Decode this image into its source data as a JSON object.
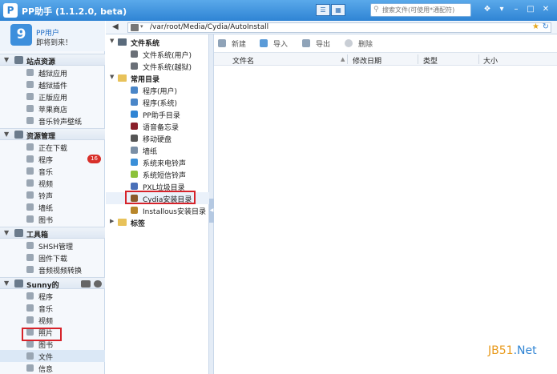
{
  "app": {
    "title": "PP助手 (1.1.2.0, beta)",
    "logo_char": "P"
  },
  "search": {
    "placeholder": "搜索文件(可使用*通配符)"
  },
  "user": {
    "name": "PP用户",
    "welcome": "即将到来！",
    "avatar_char": "9"
  },
  "sidebar": {
    "sections": [
      {
        "label": "站点资源",
        "items": [
          "越狱应用",
          "越狱插件",
          "正版应用",
          "苹果商店",
          "音乐铃声壁纸"
        ]
      },
      {
        "label": "资源管理",
        "items": [
          "正在下载",
          "程序",
          "音乐",
          "视频",
          "铃声",
          "墙纸",
          "图书"
        ],
        "badge": "16"
      },
      {
        "label": "工具箱",
        "items": [
          "SHSH管理",
          "固件下载",
          "音频视频转换"
        ]
      },
      {
        "label": "Sunny的",
        "items": [
          "程序",
          "音乐",
          "视频",
          "照片",
          "图书",
          "文件",
          "信息"
        ]
      }
    ]
  },
  "path": {
    "value": "/var/root/Media/Cydia/AutoInstall"
  },
  "tree": {
    "groups": [
      {
        "label": "文件系统",
        "items": [
          "文件系统(用户)",
          "文件系统(越狱)"
        ]
      },
      {
        "label": "常用目录",
        "items": [
          "程序(用户)",
          "程序(系统)",
          "PP助手目录",
          "语音备忘录",
          "移动硬盘",
          "墙纸",
          "系统来电铃声",
          "系统短信铃声",
          "PXL垃圾目录",
          "Cydia安装目录",
          "Installous安装目录"
        ]
      },
      {
        "label": "标签",
        "items": []
      }
    ]
  },
  "actions": {
    "new": "新建",
    "import": "导入",
    "export": "导出",
    "delete": "删除"
  },
  "table": {
    "headers": [
      "文件名",
      "修改日期",
      "类型",
      "大小"
    ]
  },
  "watermark": {
    "a": "JB51",
    "b": ".Net"
  },
  "colors": {
    "accent": "#2f84d4",
    "highlight_box": "#d6232a",
    "badge": "#d8302a"
  }
}
